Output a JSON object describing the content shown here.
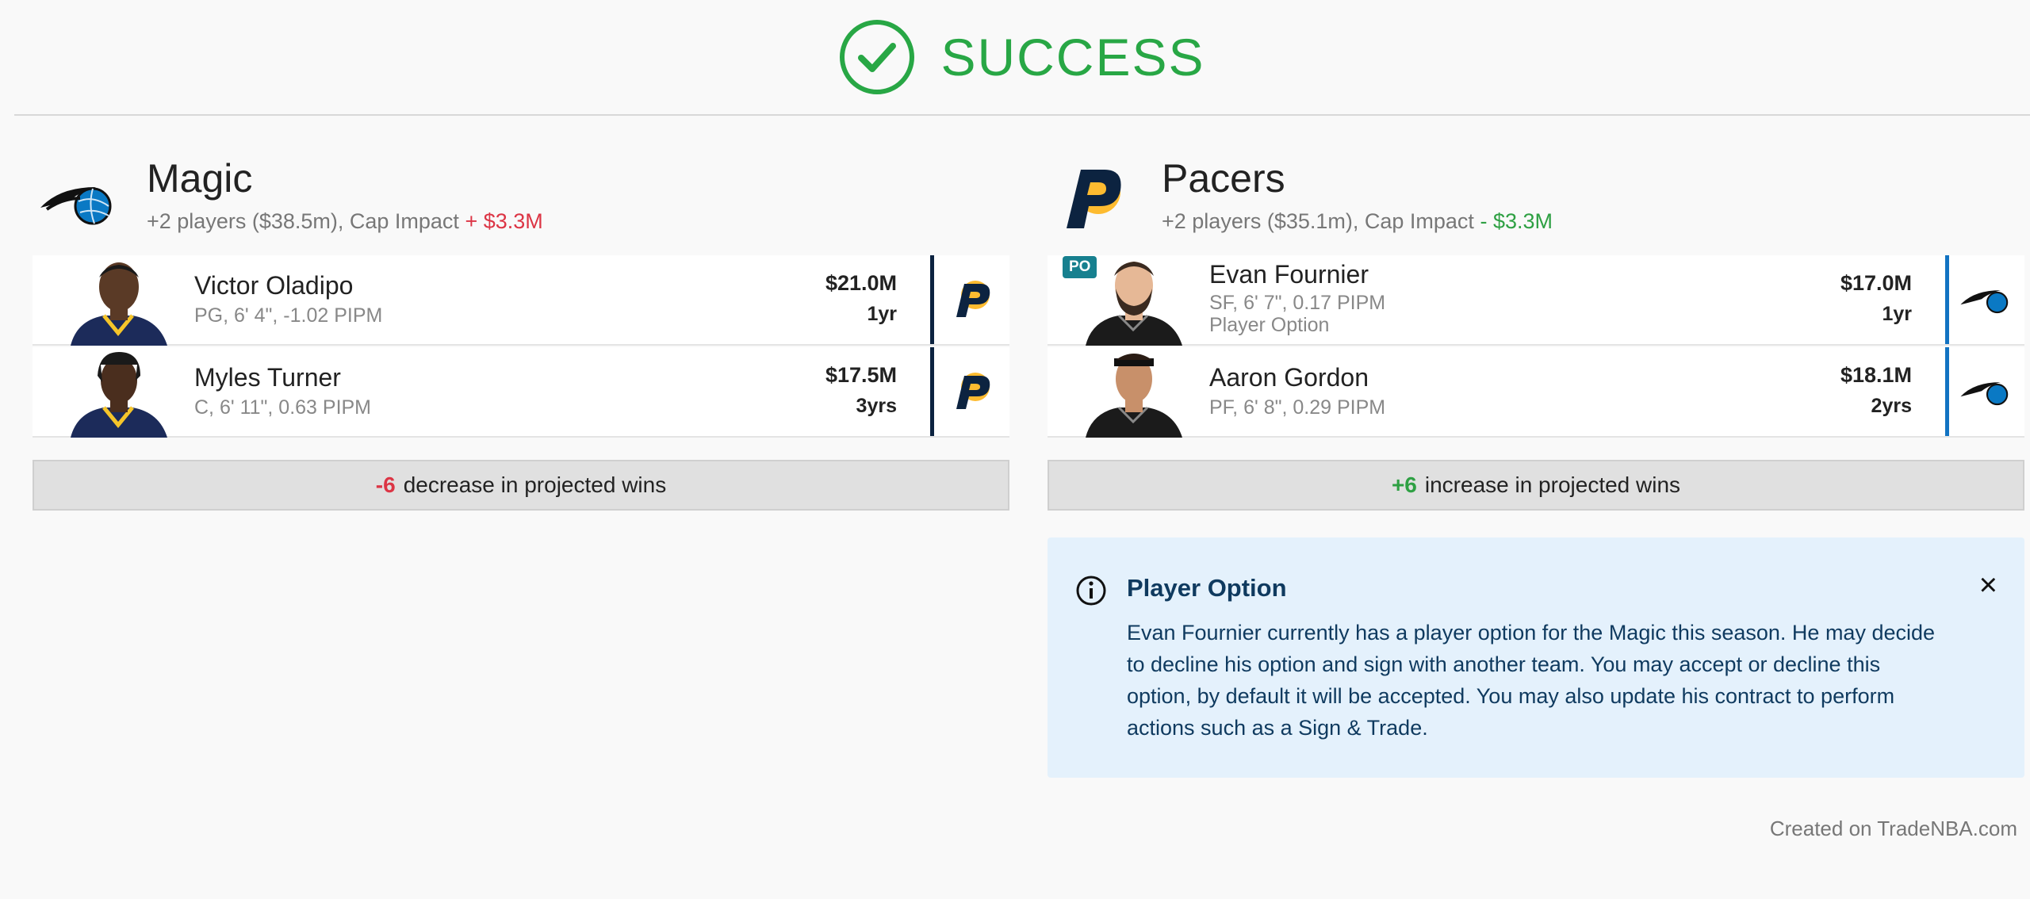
{
  "header": {
    "status": "SUCCESS"
  },
  "colors": {
    "success": "#28a745",
    "negative": "#dc3545",
    "positive": "#2ea043",
    "pacers_navy": "#0c2340",
    "magic_blue": "#1273c2"
  },
  "teams": [
    {
      "name": "Magic",
      "logo": "magic-logo-icon",
      "summary": "+2 players ($38.5m), Cap Impact",
      "cap_impact": "+ $3.3M",
      "players": [
        {
          "name": "Victor Oladipo",
          "meta": "PG, 6' 4\", -1.02 PIPM",
          "salary": "$21.0M",
          "years": "1yr",
          "from_logo": "pacers-logo-icon"
        },
        {
          "name": "Myles Turner",
          "meta": "C, 6' 11\", 0.63 PIPM",
          "salary": "$17.5M",
          "years": "3yrs",
          "from_logo": "pacers-logo-icon"
        }
      ],
      "wins_delta": "-6",
      "wins_text": "decrease in projected wins"
    },
    {
      "name": "Pacers",
      "logo": "pacers-logo-icon",
      "summary": "+2 players ($35.1m), Cap Impact",
      "cap_impact": "- $3.3M",
      "players": [
        {
          "name": "Evan Fournier",
          "meta": "SF, 6' 7\", 0.17 PIPM",
          "note": "Player Option",
          "badge": "PO",
          "salary": "$17.0M",
          "years": "1yr",
          "from_logo": "magic-logo-icon"
        },
        {
          "name": "Aaron Gordon",
          "meta": "PF, 6' 8\", 0.29 PIPM",
          "salary": "$18.1M",
          "years": "2yrs",
          "from_logo": "magic-logo-icon"
        }
      ],
      "wins_delta": "+6",
      "wins_text": "increase in projected wins"
    }
  ],
  "alert": {
    "title": "Player Option",
    "body": "Evan Fournier currently has a player option for the Magic this season. He may decide to decline his option and sign with another team. You may accept or decline this option, by default it will be accepted. You may also update his contract to perform actions such as a Sign & Trade.",
    "close": "×"
  },
  "footer": "Created on TradeNBA.com"
}
